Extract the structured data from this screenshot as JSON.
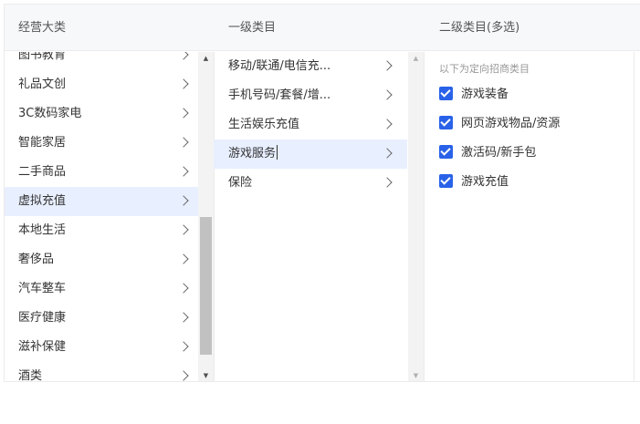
{
  "header": {
    "col1": "经营大类",
    "col2": "一级类目",
    "col3": "二级类目(多选)"
  },
  "categories": [
    {
      "label": "图书教育"
    },
    {
      "label": "礼品文创"
    },
    {
      "label": "3C数码家电"
    },
    {
      "label": "智能家居"
    },
    {
      "label": "二手商品"
    },
    {
      "label": "虚拟充值",
      "selected": true
    },
    {
      "label": "本地生活"
    },
    {
      "label": "奢侈品"
    },
    {
      "label": "汽车整车"
    },
    {
      "label": "医疗健康"
    },
    {
      "label": "滋补保健"
    },
    {
      "label": "酒类"
    }
  ],
  "level1": [
    {
      "label": "移动/联通/电信充..."
    },
    {
      "label": "手机号码/套餐/增..."
    },
    {
      "label": "生活娱乐充值"
    },
    {
      "label": "游戏服务",
      "selected": true
    },
    {
      "label": "保险"
    }
  ],
  "level2": {
    "hint": "以下为定向招商类目",
    "options": [
      {
        "label": "游戏装备",
        "checked": true
      },
      {
        "label": "网页游戏物品/资源",
        "checked": true
      },
      {
        "label": "激活码/新手包",
        "checked": true
      },
      {
        "label": "游戏充值",
        "checked": true
      }
    ]
  },
  "icons": {
    "chevron": "chevron-right-icon",
    "checkbox": "checkbox-checked-icon"
  },
  "colors": {
    "accent": "#2962e8",
    "selected_bg": "#e8efff",
    "header_bg": "#f7f8fa"
  }
}
